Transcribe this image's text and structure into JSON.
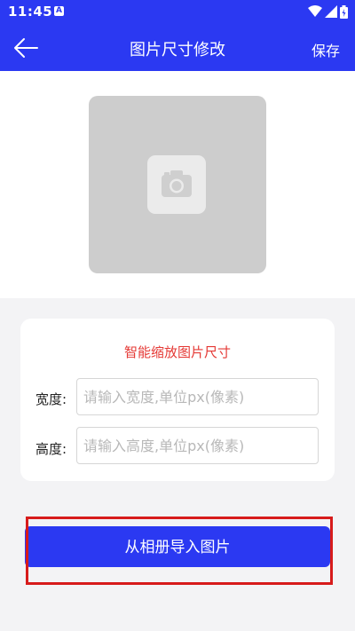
{
  "status_bar": {
    "time": "11:45",
    "app_badge": "A",
    "icons": [
      "notification-a-icon",
      "wifi-icon",
      "signal-icon",
      "battery-icon"
    ]
  },
  "header": {
    "title": "图片尺寸修改",
    "save_label": "保存",
    "back_icon": "arrow-left-icon",
    "background": "#2b39f2"
  },
  "preview": {
    "icon": "camera-icon"
  },
  "resize_card": {
    "title": "智能缩放图片尺寸",
    "title_color": "#e53935",
    "width": {
      "label": "宽度:",
      "value": "",
      "placeholder": "请输入宽度,单位px(像素)"
    },
    "height": {
      "label": "高度:",
      "value": "",
      "placeholder": "请输入高度,单位px(像素)"
    }
  },
  "import_button": {
    "label": "从相册导入图片",
    "highlighted": true,
    "highlight_color": "#d71b1b"
  }
}
